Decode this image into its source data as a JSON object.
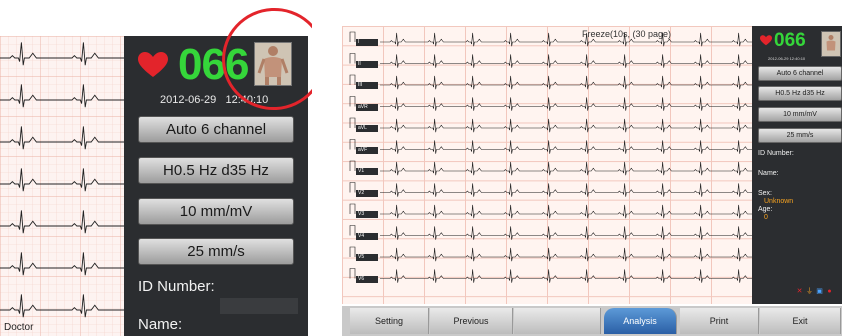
{
  "left_panel": {
    "heart_rate": "066",
    "date": "2012-06-29",
    "time": "12:40:10",
    "buttons": [
      "Auto 6 channel",
      "H0.5 Hz d35 Hz",
      "10 mm/mV",
      "25 mm/s"
    ],
    "fields": [
      "ID Number:",
      "Name:"
    ],
    "corner_label": "Doctor"
  },
  "right_panel": {
    "status": "Freeze(10s,  (30 page)",
    "leads": [
      "I",
      "II",
      "III",
      "aVR",
      "aVL",
      "aVF",
      "V1",
      "V2",
      "V3",
      "V4",
      "V5",
      "V6"
    ],
    "side": {
      "heart_rate": "066",
      "datetime": "2012-06-29  12:40:10",
      "buttons": [
        "Auto 6 channel",
        "H0.5 Hz d35 Hz",
        "10 mm/mV",
        "25 mm/s"
      ],
      "id_label": "ID Number:",
      "name_label": "Name:",
      "sex_label": "Sex:",
      "sex_value": "Unknown",
      "age_label": "Age:",
      "age_value": "0"
    },
    "bottom_buttons": [
      "Setting",
      "Previous",
      "",
      "Analysis",
      "Print",
      "Exit"
    ]
  },
  "colors": {
    "hr_green": "#35d63a",
    "accent_blue": "#2a5fa5",
    "highlight_red": "#e3242b",
    "value_orange": "#f6a321"
  }
}
